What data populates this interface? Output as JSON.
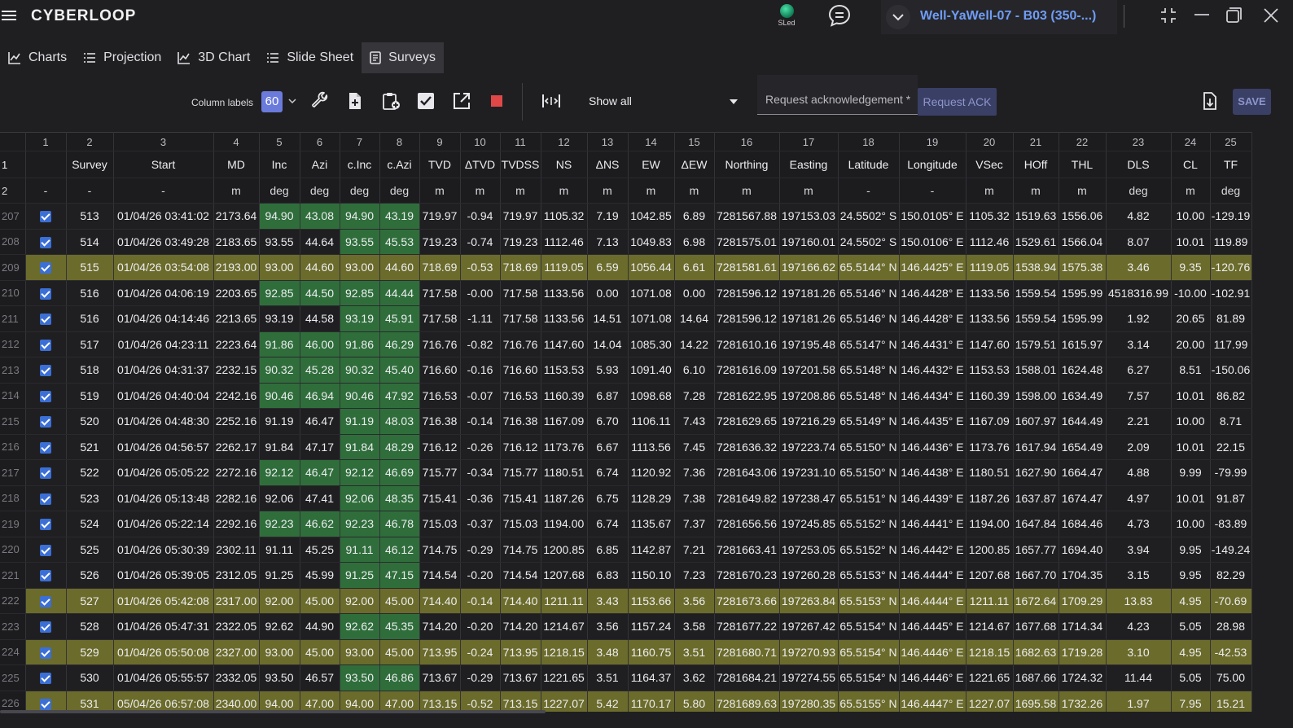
{
  "app": {
    "logo": "CYBERLOOP",
    "status_led_label": "SLed",
    "well_title": "Well-YaWell-07 - B03 (350-...)"
  },
  "tabs": [
    {
      "label": "Charts",
      "icon": "line-chart-icon"
    },
    {
      "label": "Projection",
      "icon": "list-icon"
    },
    {
      "label": "3D Chart",
      "icon": "line-chart-icon"
    },
    {
      "label": "Slide Sheet",
      "icon": "list-icon"
    },
    {
      "label": "Surveys",
      "icon": "document-icon",
      "active": true
    }
  ],
  "toolbar": {
    "column_labels_text": "Column labels",
    "column_labels_value": "60",
    "filter_value": "Show all",
    "request_placeholder": "Request acknowledgement *",
    "request_button": "Request ACK",
    "save_button": "SAVE"
  },
  "colors": {
    "accent": "#6a7bdc",
    "highlight_row": "#6b6b2c",
    "green_cell": "#2f6e3b",
    "checkbox": "#3b6fd6",
    "well_title": "#6f9cf5",
    "stop": "#e04848"
  },
  "grid": {
    "column_numbers": [
      "",
      "1",
      "2",
      "3",
      "4",
      "5",
      "6",
      "7",
      "8",
      "9",
      "10",
      "11",
      "12",
      "13",
      "14",
      "15",
      "16",
      "17",
      "18",
      "19",
      "20",
      "21",
      "22",
      "23",
      "24",
      "25"
    ],
    "header_row_label": "1",
    "unit_row_label": "2",
    "column_labels": [
      "",
      "",
      "Survey",
      "Start",
      "MD",
      "Inc",
      "Azi",
      "c.Inc",
      "c.Azi",
      "TVD",
      "ΔTVD",
      "TVDSS",
      "NS",
      "ΔNS",
      "EW",
      "ΔEW",
      "Northing",
      "Easting",
      "Latitude",
      "Longitude",
      "VSec",
      "HOff",
      "THL",
      "DLS",
      "CL",
      "TF"
    ],
    "units": [
      "",
      "-",
      "-",
      "-",
      "m",
      "deg",
      "deg",
      "deg",
      "deg",
      "m",
      "m",
      "m",
      "m",
      "m",
      "m",
      "m",
      "m",
      "m",
      "-",
      "-",
      "m",
      "m",
      "m",
      "deg",
      "m",
      "deg"
    ],
    "rows": [
      {
        "n": "207",
        "hl": false,
        "g": [
          5,
          6,
          7,
          8
        ],
        "c": [
          "513",
          "01/04/26 03:41:02",
          "2173.64",
          "94.90",
          "43.08",
          "94.90",
          "43.19",
          "719.97",
          "-0.94",
          "719.97",
          "1105.32",
          "7.19",
          "1042.85",
          "6.89",
          "7281567.88",
          "197153.03",
          "24.5502° S",
          "150.0105° E",
          "1105.32",
          "1519.63",
          "1556.06",
          "4.82",
          "10.00",
          "-129.19"
        ]
      },
      {
        "n": "208",
        "hl": false,
        "g": [
          7,
          8
        ],
        "c": [
          "514",
          "01/04/26 03:49:28",
          "2183.65",
          "93.55",
          "44.64",
          "93.55",
          "45.53",
          "719.23",
          "-0.74",
          "719.23",
          "1112.46",
          "7.13",
          "1049.83",
          "6.98",
          "7281575.01",
          "197160.01",
          "24.5502° S",
          "150.0106° E",
          "1112.46",
          "1529.61",
          "1566.04",
          "8.07",
          "10.01",
          "119.89"
        ]
      },
      {
        "n": "209",
        "hl": true,
        "g": [],
        "c": [
          "515",
          "01/04/26 03:54:08",
          "2193.00",
          "93.00",
          "44.60",
          "93.00",
          "44.60",
          "718.69",
          "-0.53",
          "718.69",
          "1119.05",
          "6.59",
          "1056.44",
          "6.61",
          "7281581.61",
          "197166.62",
          "65.5144° N",
          "146.4425° E",
          "1119.05",
          "1538.94",
          "1575.38",
          "3.46",
          "9.35",
          "-120.76"
        ]
      },
      {
        "n": "210",
        "hl": false,
        "g": [
          5,
          6,
          7,
          8
        ],
        "c": [
          "516",
          "01/04/26 04:06:19",
          "2203.65",
          "92.85",
          "44.50",
          "92.85",
          "44.44",
          "717.58",
          "-0.00",
          "717.58",
          "1133.56",
          "0.00",
          "1071.08",
          "0.00",
          "7281596.12",
          "197181.26",
          "65.5146° N",
          "146.4428° E",
          "1133.56",
          "1559.54",
          "1595.99",
          "4518316.99",
          "-10.00",
          "-102.91"
        ]
      },
      {
        "n": "211",
        "hl": false,
        "g": [
          7,
          8
        ],
        "c": [
          "516",
          "01/04/26 04:14:46",
          "2213.65",
          "93.19",
          "44.58",
          "93.19",
          "45.91",
          "717.58",
          "-1.11",
          "717.58",
          "1133.56",
          "14.51",
          "1071.08",
          "14.64",
          "7281596.12",
          "197181.26",
          "65.5146° N",
          "146.4428° E",
          "1133.56",
          "1559.54",
          "1595.99",
          "1.92",
          "20.65",
          "81.89"
        ]
      },
      {
        "n": "212",
        "hl": false,
        "g": [
          5,
          6,
          7,
          8
        ],
        "c": [
          "517",
          "01/04/26 04:23:11",
          "2223.64",
          "91.86",
          "46.00",
          "91.86",
          "46.29",
          "716.76",
          "-0.82",
          "716.76",
          "1147.60",
          "14.04",
          "1085.30",
          "14.22",
          "7281610.16",
          "197195.48",
          "65.5147° N",
          "146.4431° E",
          "1147.60",
          "1579.51",
          "1615.97",
          "3.14",
          "20.00",
          "117.99"
        ]
      },
      {
        "n": "213",
        "hl": false,
        "g": [
          5,
          6,
          7,
          8
        ],
        "c": [
          "518",
          "01/04/26 04:31:37",
          "2232.15",
          "90.32",
          "45.28",
          "90.32",
          "45.40",
          "716.60",
          "-0.16",
          "716.60",
          "1153.53",
          "5.93",
          "1091.40",
          "6.10",
          "7281616.09",
          "197201.58",
          "65.5148° N",
          "146.4432° E",
          "1153.53",
          "1588.01",
          "1624.48",
          "6.27",
          "8.51",
          "-150.06"
        ]
      },
      {
        "n": "214",
        "hl": false,
        "g": [
          5,
          6,
          7,
          8
        ],
        "c": [
          "519",
          "01/04/26 04:40:04",
          "2242.16",
          "90.46",
          "46.94",
          "90.46",
          "47.92",
          "716.53",
          "-0.07",
          "716.53",
          "1160.39",
          "6.87",
          "1098.68",
          "7.28",
          "7281622.95",
          "197208.86",
          "65.5148° N",
          "146.4434° E",
          "1160.39",
          "1598.00",
          "1634.49",
          "7.57",
          "10.01",
          "86.82"
        ]
      },
      {
        "n": "215",
        "hl": false,
        "g": [
          7,
          8
        ],
        "c": [
          "520",
          "01/04/26 04:48:30",
          "2252.16",
          "91.19",
          "46.47",
          "91.19",
          "48.03",
          "716.38",
          "-0.14",
          "716.38",
          "1167.09",
          "6.70",
          "1106.11",
          "7.43",
          "7281629.65",
          "197216.29",
          "65.5149° N",
          "146.4435° E",
          "1167.09",
          "1607.97",
          "1644.49",
          "2.21",
          "10.00",
          "8.71"
        ]
      },
      {
        "n": "216",
        "hl": false,
        "g": [
          7,
          8
        ],
        "c": [
          "521",
          "01/04/26 04:56:57",
          "2262.17",
          "91.84",
          "47.17",
          "91.84",
          "48.29",
          "716.12",
          "-0.26",
          "716.12",
          "1173.76",
          "6.67",
          "1113.56",
          "7.45",
          "7281636.32",
          "197223.74",
          "65.5150° N",
          "146.4436° E",
          "1173.76",
          "1617.94",
          "1654.49",
          "2.09",
          "10.01",
          "22.15"
        ]
      },
      {
        "n": "217",
        "hl": false,
        "g": [
          5,
          6,
          7,
          8
        ],
        "c": [
          "522",
          "01/04/26 05:05:22",
          "2272.16",
          "92.12",
          "46.47",
          "92.12",
          "46.69",
          "715.77",
          "-0.34",
          "715.77",
          "1180.51",
          "6.74",
          "1120.92",
          "7.36",
          "7281643.06",
          "197231.10",
          "65.5150° N",
          "146.4438° E",
          "1180.51",
          "1627.90",
          "1664.47",
          "4.88",
          "9.99",
          "-79.99"
        ]
      },
      {
        "n": "218",
        "hl": false,
        "g": [
          7,
          8
        ],
        "c": [
          "523",
          "01/04/26 05:13:48",
          "2282.16",
          "92.06",
          "47.41",
          "92.06",
          "48.35",
          "715.41",
          "-0.36",
          "715.41",
          "1187.26",
          "6.75",
          "1128.29",
          "7.38",
          "7281649.82",
          "197238.47",
          "65.5151° N",
          "146.4439° E",
          "1187.26",
          "1637.87",
          "1674.47",
          "4.97",
          "10.01",
          "91.87"
        ]
      },
      {
        "n": "219",
        "hl": false,
        "g": [
          5,
          6,
          7,
          8
        ],
        "c": [
          "524",
          "01/04/26 05:22:14",
          "2292.16",
          "92.23",
          "46.62",
          "92.23",
          "46.78",
          "715.03",
          "-0.37",
          "715.03",
          "1194.00",
          "6.74",
          "1135.67",
          "7.37",
          "7281656.56",
          "197245.85",
          "65.5152° N",
          "146.4441° E",
          "1194.00",
          "1647.84",
          "1684.46",
          "4.73",
          "10.00",
          "-83.89"
        ]
      },
      {
        "n": "220",
        "hl": false,
        "g": [
          7,
          8
        ],
        "c": [
          "525",
          "01/04/26 05:30:39",
          "2302.11",
          "91.11",
          "45.25",
          "91.11",
          "46.12",
          "714.75",
          "-0.29",
          "714.75",
          "1200.85",
          "6.85",
          "1142.87",
          "7.21",
          "7281663.41",
          "197253.05",
          "65.5152° N",
          "146.4442° E",
          "1200.85",
          "1657.77",
          "1694.40",
          "3.94",
          "9.95",
          "-149.24"
        ]
      },
      {
        "n": "221",
        "hl": false,
        "g": [
          7,
          8
        ],
        "c": [
          "526",
          "01/04/26 05:39:05",
          "2312.05",
          "91.25",
          "45.99",
          "91.25",
          "47.15",
          "714.54",
          "-0.20",
          "714.54",
          "1207.68",
          "6.83",
          "1150.10",
          "7.23",
          "7281670.23",
          "197260.28",
          "65.5153° N",
          "146.4444° E",
          "1207.68",
          "1667.70",
          "1704.35",
          "3.15",
          "9.95",
          "82.29"
        ]
      },
      {
        "n": "222",
        "hl": true,
        "g": [],
        "c": [
          "527",
          "01/04/26 05:42:08",
          "2317.00",
          "92.00",
          "45.00",
          "92.00",
          "45.00",
          "714.40",
          "-0.14",
          "714.40",
          "1211.11",
          "3.43",
          "1153.66",
          "3.56",
          "7281673.66",
          "197263.84",
          "65.5153° N",
          "146.4444° E",
          "1211.11",
          "1672.64",
          "1709.29",
          "13.83",
          "4.95",
          "-70.69"
        ]
      },
      {
        "n": "223",
        "hl": false,
        "g": [
          7,
          8
        ],
        "c": [
          "528",
          "01/04/26 05:47:31",
          "2322.05",
          "92.62",
          "44.90",
          "92.62",
          "45.35",
          "714.20",
          "-0.20",
          "714.20",
          "1214.67",
          "3.56",
          "1157.24",
          "3.58",
          "7281677.22",
          "197267.42",
          "65.5154° N",
          "146.4445° E",
          "1214.67",
          "1677.68",
          "1714.34",
          "4.23",
          "5.05",
          "28.98"
        ]
      },
      {
        "n": "224",
        "hl": true,
        "g": [],
        "c": [
          "529",
          "01/04/26 05:50:08",
          "2327.00",
          "93.00",
          "45.00",
          "93.00",
          "45.00",
          "713.95",
          "-0.24",
          "713.95",
          "1218.15",
          "3.48",
          "1160.75",
          "3.51",
          "7281680.71",
          "197270.93",
          "65.5154° N",
          "146.4446° E",
          "1218.15",
          "1682.63",
          "1719.28",
          "3.10",
          "4.95",
          "-42.53"
        ]
      },
      {
        "n": "225",
        "hl": false,
        "g": [
          7,
          8
        ],
        "c": [
          "530",
          "01/04/26 05:55:57",
          "2332.05",
          "93.50",
          "46.57",
          "93.50",
          "46.86",
          "713.67",
          "-0.29",
          "713.67",
          "1221.65",
          "3.51",
          "1164.37",
          "3.62",
          "7281684.21",
          "197274.55",
          "65.5154° N",
          "146.4446° E",
          "1221.65",
          "1687.66",
          "1724.32",
          "11.44",
          "5.05",
          "75.00"
        ]
      },
      {
        "n": "226",
        "hl": true,
        "g": [],
        "c": [
          "531",
          "05/04/26 06:57:08",
          "2340.00",
          "94.00",
          "47.00",
          "94.00",
          "47.00",
          "713.15",
          "-0.52",
          "713.15",
          "1227.07",
          "5.42",
          "1170.17",
          "5.80",
          "7281689.63",
          "197280.35",
          "65.5155° N",
          "146.4447° E",
          "1227.07",
          "1695.58",
          "1732.26",
          "1.97",
          "7.95",
          "15.21"
        ]
      }
    ]
  }
}
